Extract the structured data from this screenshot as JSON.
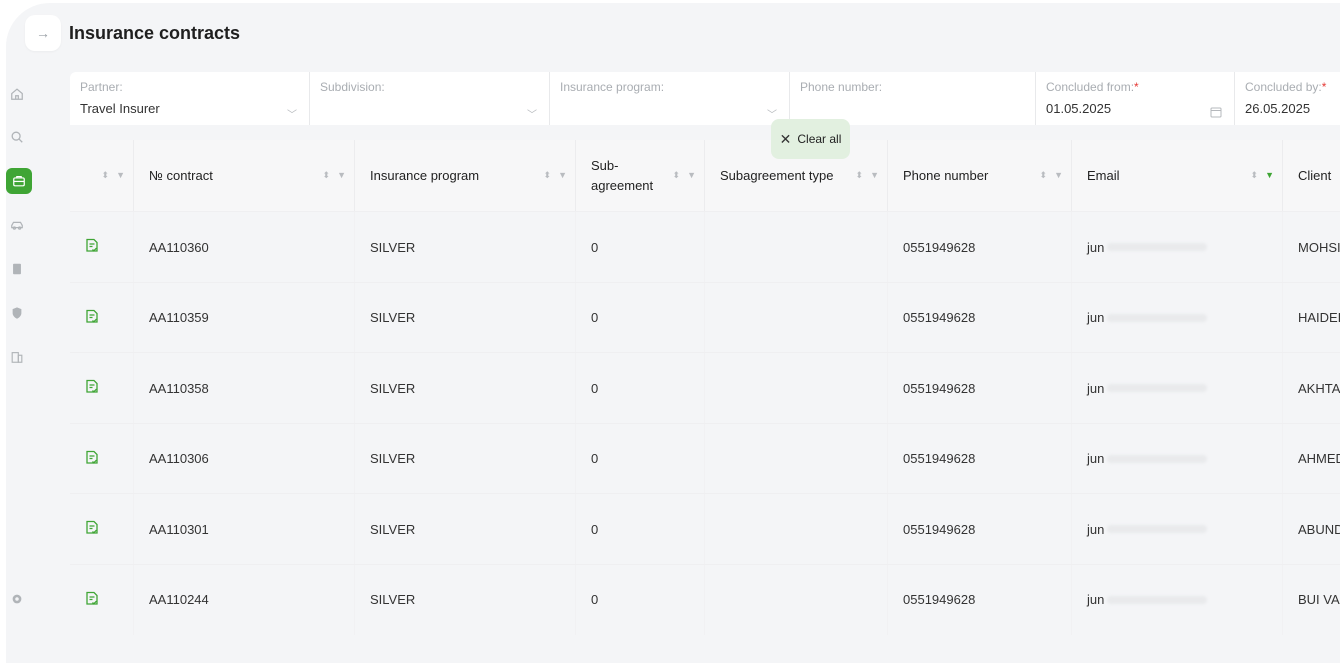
{
  "page": {
    "title": "Insurance contracts"
  },
  "sidebar": {
    "collapse_icon": "arrow-right-icon",
    "items": [
      {
        "icon": "home-icon",
        "active": false
      },
      {
        "icon": "search-icon",
        "active": false
      },
      {
        "icon": "briefcase-icon",
        "active": true
      },
      {
        "icon": "car-icon",
        "active": false
      },
      {
        "icon": "document-icon",
        "active": false
      },
      {
        "icon": "shield-icon",
        "active": false
      },
      {
        "icon": "building-icon",
        "active": false
      }
    ],
    "settings_icon": "gear-icon"
  },
  "filters": {
    "partner": {
      "label": "Partner:",
      "value": "Travel Insurer"
    },
    "subdivision": {
      "label": "Subdivision:",
      "value": ""
    },
    "insurance_program": {
      "label": "Insurance program:",
      "value": ""
    },
    "phone_number": {
      "label": "Phone number:",
      "value": ""
    },
    "concluded_from": {
      "label": "Concluded from:",
      "required": "*",
      "value": "01.05.2025"
    },
    "concluded_by": {
      "label": "Concluded by:",
      "required": "*",
      "value": "26.05.2025"
    },
    "clear_all": "Clear all"
  },
  "table": {
    "columns": {
      "contract": "№ contract",
      "program": "Insurance program",
      "subagreement": "Sub-agreement",
      "subagreement_type": "Subagreement type",
      "phone": "Phone number",
      "email": "Email",
      "client": "Client"
    },
    "rows": [
      {
        "contract": "AA110360",
        "program": "SILVER",
        "sub": "0",
        "subtype": "",
        "phone": "0551949628",
        "email_prefix": "jun",
        "client": "MOHSI"
      },
      {
        "contract": "AA110359",
        "program": "SILVER",
        "sub": "0",
        "subtype": "",
        "phone": "0551949628",
        "email_prefix": "jun",
        "client": "HAIDER"
      },
      {
        "contract": "AA110358",
        "program": "SILVER",
        "sub": "0",
        "subtype": "",
        "phone": "0551949628",
        "email_prefix": "jun",
        "client": "AKHTAI"
      },
      {
        "contract": "AA110306",
        "program": "SILVER",
        "sub": "0",
        "subtype": "",
        "phone": "0551949628",
        "email_prefix": "jun",
        "client": "AHMED"
      },
      {
        "contract": "AA110301",
        "program": "SILVER",
        "sub": "0",
        "subtype": "",
        "phone": "0551949628",
        "email_prefix": "jun",
        "client": "ABUND"
      },
      {
        "contract": "AA110244",
        "program": "SILVER",
        "sub": "0",
        "subtype": "",
        "phone": "0551949628",
        "email_prefix": "jun",
        "client": "BUI VA"
      }
    ]
  },
  "colors": {
    "accent": "#3fa535",
    "required": "#e53935",
    "clear_bg": "#e2f0e0"
  }
}
